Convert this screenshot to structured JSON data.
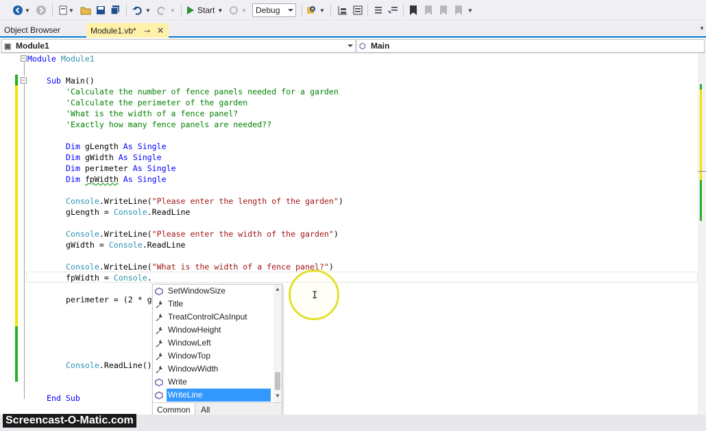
{
  "toolbar": {
    "start_label": "Start",
    "config_value": "Debug"
  },
  "tabs": [
    {
      "label": "Object Browser"
    },
    {
      "label": "Module1.vb*"
    }
  ],
  "navbar": {
    "left_value": "Module1",
    "right_value": "Main"
  },
  "code": {
    "module_kw": "Module",
    "module_name": "Module1",
    "sub_decl": "Sub",
    "sub_name": " Main()",
    "comments": [
      "'Calculate the number of fence panels needed for a garden",
      "'Calculate the perimeter of the garden",
      "'What is the width of a fence panel?",
      "'Exactly how many fence panels are needed??"
    ],
    "dims": [
      {
        "kw": "Dim",
        "name": " gLength ",
        "as": "As",
        "type": " Single"
      },
      {
        "kw": "Dim",
        "name": " gWidth ",
        "as": "As",
        "type": " Single"
      },
      {
        "kw": "Dim",
        "name": " perimeter ",
        "as": "As",
        "type": " Single"
      },
      {
        "kw": "Dim",
        "name_pre": " ",
        "name_squig": "fpWidth",
        "name_post": " ",
        "as": "As",
        "type": " Single"
      }
    ],
    "console": "Console",
    "writeline": ".WriteLine(",
    "readline_assign": ".ReadLine",
    "str1": "\"Please enter the length of the garden\"",
    "str2": "\"Please enter the width of the garden\"",
    "str3": "\"What is the width of a fence panel?\"",
    "close_paren": ")",
    "glength_assign": "gLength = ",
    "gwidth_assign": "gWidth = ",
    "fpwidth_assign": "fpWidth = ",
    "dot": ".",
    "perimeter_line": "perimeter = (2 * g",
    "readline_call": ".ReadLine()",
    "end_sub": "End Sub"
  },
  "intellisense": {
    "items": [
      {
        "label": "SetWindowSize",
        "icon": "method-icon"
      },
      {
        "label": "Title",
        "icon": "property-icon"
      },
      {
        "label": "TreatControlCAsInput",
        "icon": "property-icon"
      },
      {
        "label": "WindowHeight",
        "icon": "property-icon"
      },
      {
        "label": "WindowLeft",
        "icon": "property-icon"
      },
      {
        "label": "WindowTop",
        "icon": "property-icon"
      },
      {
        "label": "WindowWidth",
        "icon": "property-icon"
      },
      {
        "label": "Write",
        "icon": "method-icon"
      },
      {
        "label": "WriteLine",
        "icon": "method-icon",
        "selected": true
      }
    ],
    "tab_common": "Common",
    "tab_all": "All"
  },
  "watermark": "Screencast-O-Matic.com",
  "colors": {
    "keyword": "#0000ff",
    "type": "#2b91af",
    "comment": "#008000",
    "string": "#a31515",
    "selection": "#3399ff",
    "active_tab": "#fff1a8",
    "accent": "#007acc"
  }
}
